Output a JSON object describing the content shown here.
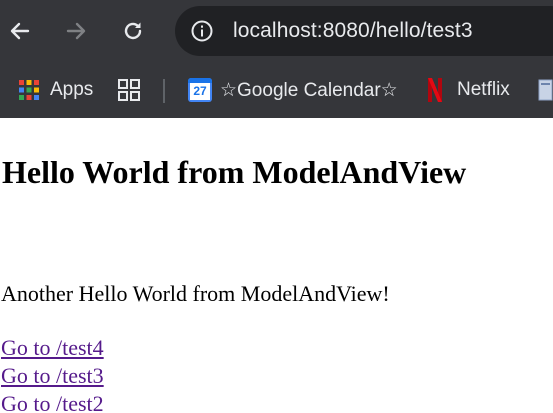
{
  "browser": {
    "url": "localhost:8080/hello/test3",
    "bookmarks": [
      {
        "label": "Apps",
        "icon": "apps-grid-icon"
      },
      {
        "label": "",
        "icon": "tab-groups-icon"
      },
      {
        "label": "☆Google Calendar☆",
        "icon": "google-calendar-icon",
        "icon_text": "27"
      },
      {
        "label": "Netflix",
        "icon": "netflix-icon"
      }
    ]
  },
  "page": {
    "title": "Hello World from ModelAndView",
    "message": "Another Hello World from ModelAndView!",
    "links": [
      {
        "label": "Go to /test4"
      },
      {
        "label": "Go to /test3"
      },
      {
        "label": "Go to /test2"
      }
    ]
  },
  "colors": {
    "chrome_bg": "#35363a",
    "omnibox_bg": "#202124",
    "link_visited": "#551a8b"
  }
}
